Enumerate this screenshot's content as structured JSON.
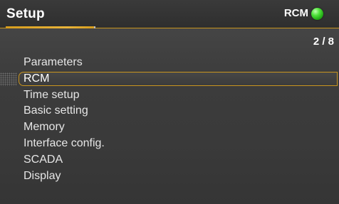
{
  "header": {
    "title": "Setup",
    "status_label": "RCM",
    "status_led_color": "#3fd62e",
    "accent_color": "#d79d1d"
  },
  "page_counter": "2 / 8",
  "menu": {
    "selected_index": 1,
    "items": [
      {
        "label": "Parameters"
      },
      {
        "label": "RCM"
      },
      {
        "label": "Time setup"
      },
      {
        "label": "Basic setting"
      },
      {
        "label": "Memory"
      },
      {
        "label": "Interface config."
      },
      {
        "label": "SCADA"
      },
      {
        "label": "Display"
      }
    ]
  }
}
